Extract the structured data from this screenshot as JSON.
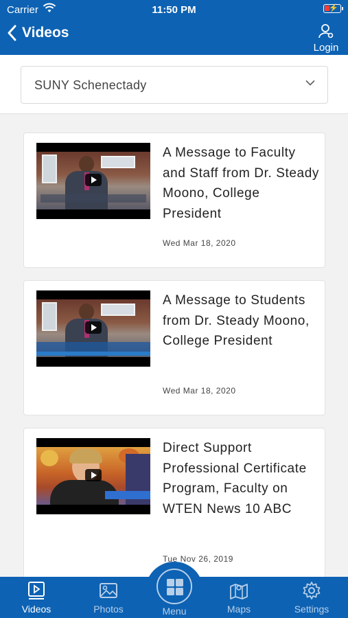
{
  "status_bar": {
    "carrier": "Carrier",
    "time": "11:50 PM"
  },
  "header": {
    "back_title": "Videos",
    "login_label": "Login"
  },
  "filter": {
    "selected": "SUNY Schenectady"
  },
  "videos": [
    {
      "title": "A Message to Faculty and Staff from Dr. Steady Moono, College President",
      "date": "Wed Mar 18, 2020"
    },
    {
      "title": "A Message to Students from Dr. Steady Moono, College President",
      "date": "Wed Mar 18, 2020"
    },
    {
      "title": "Direct Support Professional Certificate Program, Faculty on WTEN News 10 ABC",
      "date": "Tue Nov 26, 2019"
    }
  ],
  "tabbar": {
    "videos": "Videos",
    "photos": "Photos",
    "menu": "Menu",
    "maps": "Maps",
    "settings": "Settings"
  },
  "colors": {
    "brand": "#0d62b3",
    "inactive_tab": "#b7cfe9"
  }
}
